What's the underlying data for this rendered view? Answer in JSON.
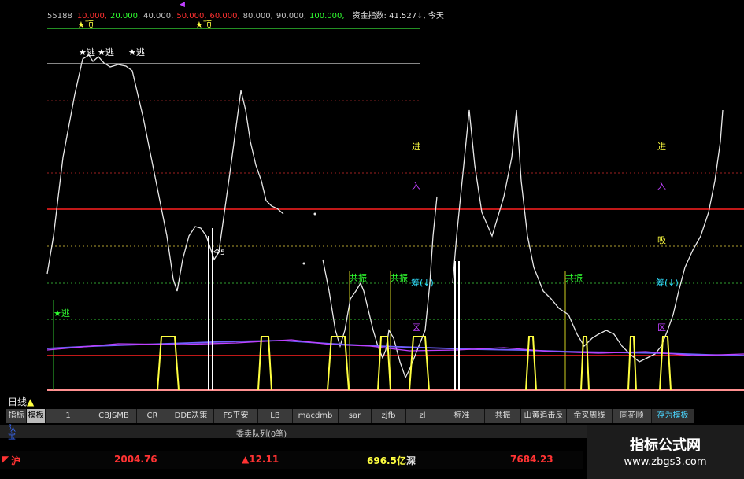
{
  "legend": {
    "id": "55188",
    "levels": [
      {
        "text": "10.000,",
        "color": "#ff3030"
      },
      {
        "text": "20.000,",
        "color": "#30ff30"
      },
      {
        "text": "40.000,",
        "color": "#c0c0c0"
      },
      {
        "text": "50.000,",
        "color": "#ff3030"
      },
      {
        "text": "60.000,",
        "color": "#ff3030"
      },
      {
        "text": "80.000,",
        "color": "#c0c0c0"
      },
      {
        "text": "90.000,",
        "color": "#c0c0c0"
      },
      {
        "text": "100.000,",
        "color": "#30ff30"
      }
    ],
    "fund_index": "资金指数: 41.527↓, 今天"
  },
  "chart_labels": {
    "top": "★顶",
    "escape": "★逃",
    "enter": "进",
    "in": "入",
    "absorb": "吸",
    "chip": "筹(↓)",
    "zone": "区",
    "resonance": "共振",
    "small_label": "今5"
  },
  "period": {
    "label": "日线"
  },
  "tabs": [
    {
      "label": "指标",
      "active": false
    },
    {
      "label": "模板",
      "active": true
    },
    {
      "label": "1",
      "active": false
    },
    {
      "label": "CBJSMB",
      "active": false
    },
    {
      "label": "CR",
      "active": false
    },
    {
      "label": "DDE决策",
      "active": false
    },
    {
      "label": "FS平安",
      "active": false
    },
    {
      "label": "LB",
      "active": false
    },
    {
      "label": "macdmb",
      "active": false
    },
    {
      "label": "sar",
      "active": false
    },
    {
      "label": "zjfb",
      "active": false
    },
    {
      "label": "zl",
      "active": false
    },
    {
      "label": "标准",
      "active": false
    },
    {
      "label": "共振",
      "active": false
    },
    {
      "label": "山黄追击反",
      "active": false
    },
    {
      "label": "金叉周线",
      "active": false
    },
    {
      "label": "同花顺",
      "active": false
    },
    {
      "label": "存为模板",
      "active": false
    }
  ],
  "queue": {
    "title": "委卖队列(0笔)",
    "mark": "队\n宝"
  },
  "status": {
    "sh_label": "沪",
    "sh_value": "2004.76",
    "change": "▲12.11",
    "turnover": "696.5亿",
    "sz_label": "深",
    "sz_value": "7684.23"
  },
  "watermark": {
    "title": "指标公式网",
    "url": "www.zbgs3.com"
  },
  "colors": {
    "up": "#ff3333",
    "yellow": "#ffff40",
    "green": "#30ff30",
    "purple": "#c040ff",
    "cyan": "#30e0ff"
  }
}
